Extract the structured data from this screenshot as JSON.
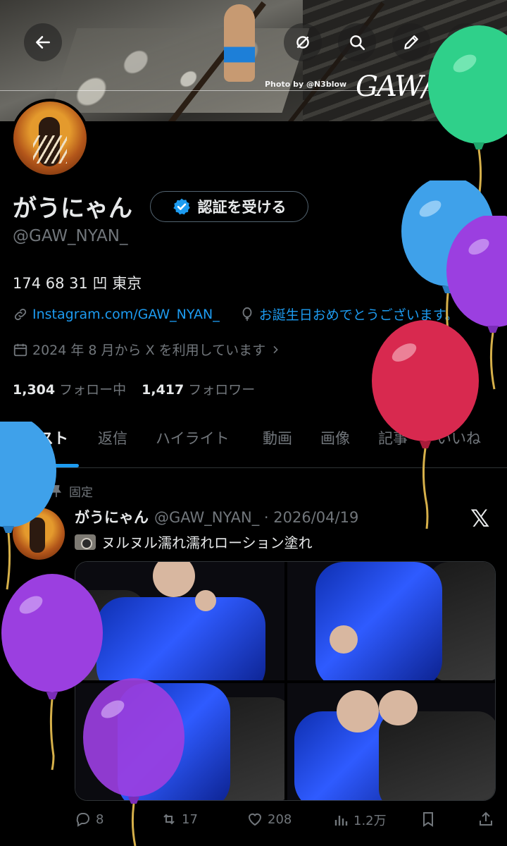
{
  "banner": {
    "photo_credit": "Photo by @N3blow",
    "brand_text": "GAW/NYAN"
  },
  "topbar": {
    "back_icon": "arrow-left-icon",
    "icons": [
      "timeline-off-icon",
      "search-icon",
      "pencil-icon",
      "share-icon"
    ]
  },
  "profile": {
    "name": "がうにゃん",
    "verify_button": "認証を受ける",
    "handle": "@GAW_NYAN_",
    "bio": "174 68 31 凹 東京",
    "link": "Instagram.com/GAW_NYAN_",
    "birthday": "お誕生日おめでとうございます。",
    "joined": "2024 年 8 月から X を利用しています",
    "following_count": "1,304",
    "following_label": "フォロー中",
    "followers_count": "1,417",
    "followers_label": "フォロワー"
  },
  "tabs": [
    "ポスト",
    "返信",
    "ハイライト",
    "動画",
    "画像",
    "記事",
    "いいね"
  ],
  "post": {
    "pinned_label": "固定",
    "name": "がうにゃん",
    "handle_date": "@GAW_NYAN_ · 2026/04/19",
    "text": "ヌルヌル濡れ濡れローション塗れ",
    "actions": {
      "replies": "8",
      "reposts": "17",
      "likes": "208",
      "views": "1.2万"
    }
  },
  "colors": {
    "accent": "#1d9bf0",
    "muted": "#71767b",
    "text": "#e7e9ea",
    "background": "#000000"
  }
}
